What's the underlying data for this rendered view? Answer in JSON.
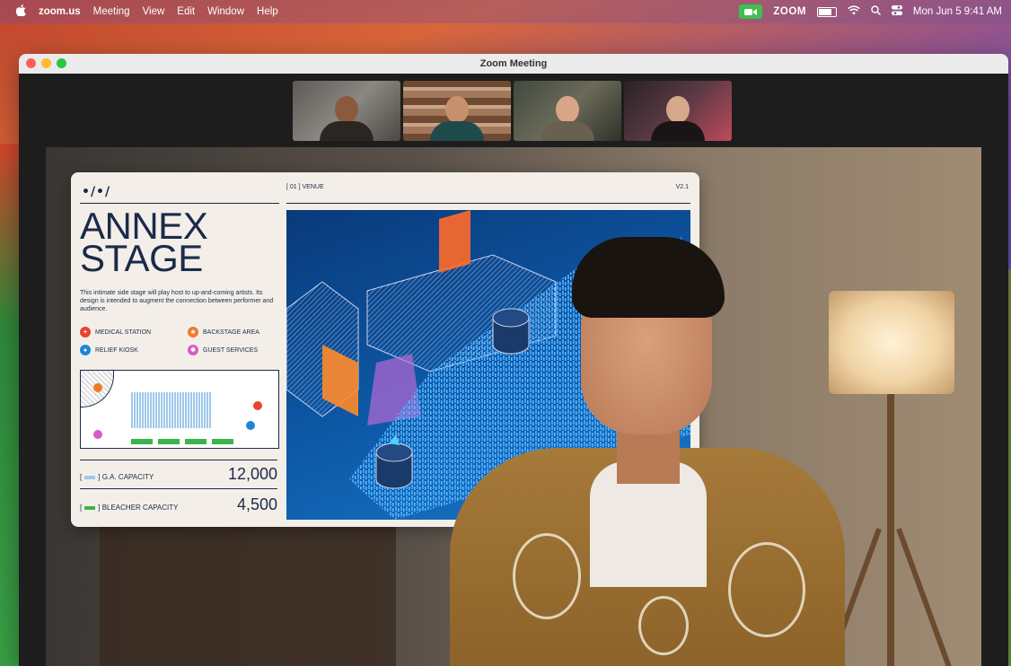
{
  "menubar": {
    "apple": "",
    "app_name": "zoom.us",
    "menus": [
      "Meeting",
      "View",
      "Edit",
      "Window",
      "Help"
    ],
    "zoom_word": "ZOOM",
    "datetime": "Mon Jun 5  9:41 AM"
  },
  "window": {
    "title": "Zoom Meeting"
  },
  "poster": {
    "logo": "•/•/",
    "venue_label": "[ 01 ] VENUE",
    "version": "V2.1",
    "title_line1": "ANNEX",
    "title_line2": "STAGE",
    "description": "This intimate side stage will play host to up-and-coming artists. Its design is intended to augment the connection between performer and audience.",
    "legend": [
      {
        "label": "MEDICAL STATION",
        "color": "#e8452f"
      },
      {
        "label": "BACKSTAGE AREA",
        "color": "#f07a2a"
      },
      {
        "label": "RELIEF KIOSK",
        "color": "#1f86d6"
      },
      {
        "label": "GUEST SERVICES",
        "color": "#d75ac8"
      }
    ],
    "capacities": [
      {
        "label": "G.A. CAPACITY",
        "value": "12,000",
        "swatch": "#9fc8ec"
      },
      {
        "label": "BLEACHER CAPACITY",
        "value": "4,500",
        "swatch": "#39b54a"
      }
    ]
  },
  "colors": {
    "zoom_green": "#3fbf4f",
    "poster_navy": "#1b2a4a"
  }
}
